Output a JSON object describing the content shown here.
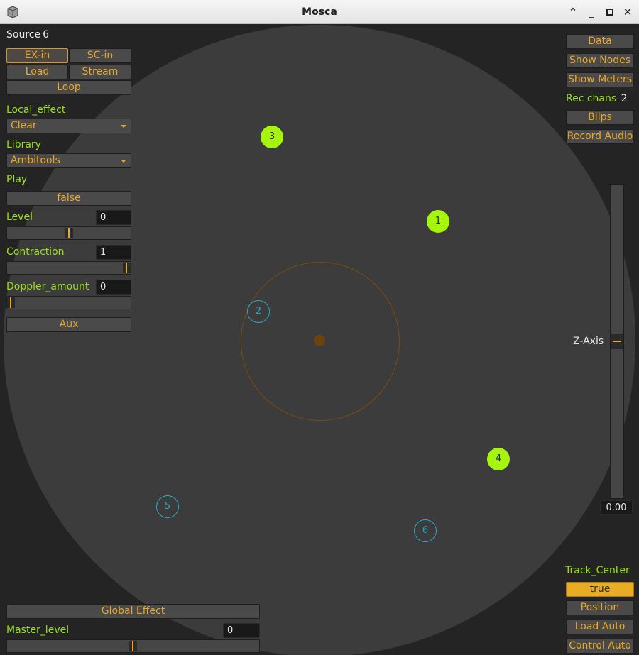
{
  "window": {
    "title": "Mosca"
  },
  "left": {
    "source_label": "Source",
    "source_value": "6",
    "ex_in": "EX-in",
    "sc_in": "SC-in",
    "load": "Load",
    "stream": "Stream",
    "loop": "Loop",
    "local_effect_label": "Local_effect",
    "local_effect_value": "Clear",
    "library_label": "Library",
    "library_value": "Ambitools",
    "play_label": "Play",
    "play_value": "false",
    "level_label": "Level",
    "level_value": "0",
    "level_fraction": 0.5,
    "contraction_label": "Contraction",
    "contraction_value": "1",
    "contraction_fraction": 1.0,
    "doppler_label": "Doppler_amount",
    "doppler_value": "0",
    "doppler_fraction": 0.0,
    "aux": "Aux",
    "global_effect": "Global Effect",
    "master_level_label": "Master_level",
    "master_level_value": "0",
    "master_level_fraction": 0.5
  },
  "right": {
    "data": "Data",
    "show_nodes": "Show Nodes",
    "show_meters": "Show Meters",
    "rec_chans_label": "Rec chans",
    "rec_chans_value": "2",
    "bilps": "Bilps",
    "record_audio": "Record Audio",
    "z_axis_label": "Z-Axis",
    "z_axis_value": "0.00",
    "z_axis_fraction": 0.5,
    "track_center_label": "Track_Center",
    "track_center_value": "true",
    "position": "Position",
    "load_auto": "Load Auto",
    "control_auto": "Control Auto"
  },
  "sources": [
    {
      "label": "1",
      "active": true
    },
    {
      "label": "2",
      "active": false
    },
    {
      "label": "3",
      "active": true
    },
    {
      "label": "4",
      "active": true
    },
    {
      "label": "5",
      "active": false
    },
    {
      "label": "6",
      "active": false
    }
  ],
  "colors": {
    "accent": "#e9a82a",
    "label_green": "#9ae01c",
    "source_active": "#a6f50e",
    "source_inactive": "#2aa7c4"
  }
}
